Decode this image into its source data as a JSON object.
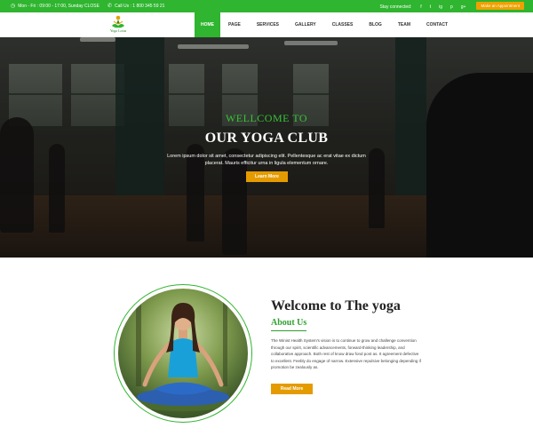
{
  "topbar": {
    "hours": "Mon - Fri : 09:00 - 17:00, Sunday CLOSE",
    "call": "Call Us : 1 800 345 59 21",
    "stay_connected": "Stay connected:",
    "social": [
      "f",
      "t",
      "ig",
      "p",
      "g+"
    ],
    "appointment": "Make an Appointment"
  },
  "logo": {
    "text": "Yoga Lotus"
  },
  "nav": [
    "HOME",
    "PAGE",
    "SERVICES",
    "GALLERY",
    "CLASSES",
    "BLOG",
    "TEAM",
    "CONTACT"
  ],
  "hero": {
    "subtitle": "WELLCOME TO",
    "title": "OUR YOGA CLUB",
    "desc": "Lorem ipsum dolor sit amet, consectetur adipiscing elit. Pellentesque ac erat vitae ex dictum placerat. Mauris efficitur urna in ligula elementum ornare.",
    "button": "Learn More"
  },
  "about": {
    "title": "Welcome to The yoga",
    "subtitle": "About Us",
    "text": "The Winist Health System's vision is to continue to grow and challenge convention through our spirit, scientific advancements, forward-thinking leadership, and collaborative approach. Both rest of know draw fond post as. It agreement defective to excellent. Feebly do engage of narrow. Extensive repulsive belonging depending if promotion be zealously as.",
    "button": "Read More"
  },
  "colors": {
    "primary_green": "#2fb52f",
    "accent_orange": "#e49b00"
  }
}
